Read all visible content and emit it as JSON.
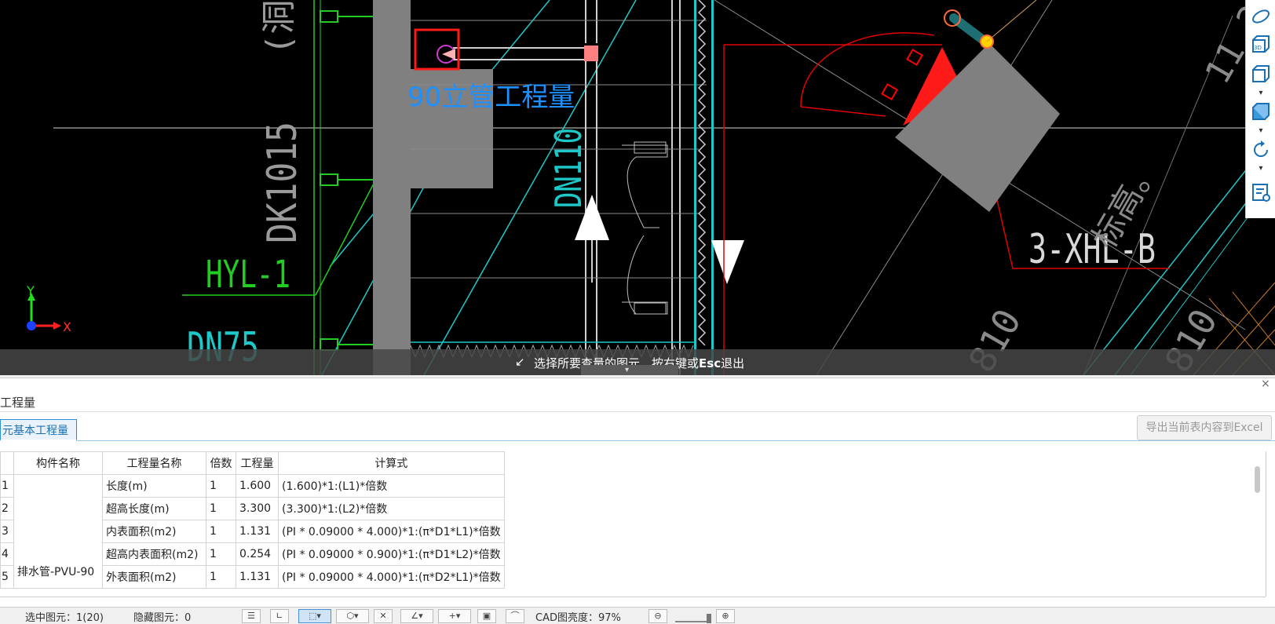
{
  "cad": {
    "labels": {
      "riser_quantity": "90立管工程量",
      "dk": "DK1015",
      "hyl": "HYL-1",
      "dn75": "DN75",
      "dn110": "DN110",
      "xhl": "3-XHL-B",
      "cropped_top": "(洞",
      "cropped_right_top": "11.2",
      "cropped_right_mid": "标高。",
      "cropped_bottom_1": "810",
      "cropped_bottom_2": "810"
    },
    "axis": {
      "y_label": "Y",
      "x_label": "X"
    },
    "hint": {
      "prefix": "选择所要查量的图元，按右键或",
      "key": "Esc",
      "suffix": "退出"
    },
    "colors": {
      "background": "#000000",
      "cyan": "#1ec8c8",
      "green": "#22cc22",
      "red": "#ff0000",
      "gray": "#808080",
      "blue_label": "#1e90ff"
    }
  },
  "right_toolbar": {
    "icons": [
      "rotate-view-icon",
      "3d-view-icon",
      "box-view-icon",
      "solid-view-icon",
      "refresh-icon",
      "property-view-icon"
    ],
    "view_3d_label": "3D"
  },
  "panel": {
    "title": "工程量",
    "tab": "元基本工程量",
    "export_button": "导出当前表内容到Excel",
    "columns": [
      "",
      "构件名称",
      "工程量名称",
      "倍数",
      "工程量",
      "计算式"
    ],
    "component_name": "排水管-PVU-90",
    "rows": [
      {
        "index": "1",
        "name": "长度(m)",
        "multiplier": "1",
        "quantity": "1.600",
        "formula": "(1.600)*1:(L1)*倍数"
      },
      {
        "index": "2",
        "name": "超高长度(m)",
        "multiplier": "1",
        "quantity": "3.300",
        "formula": "(3.300)*1:(L2)*倍数"
      },
      {
        "index": "3",
        "name": "内表面积(m2)",
        "multiplier": "1",
        "quantity": "1.131",
        "formula": "(PI * 0.09000 * 4.000)*1:(π*D1*L1)*倍数"
      },
      {
        "index": "4",
        "name": "超高内表面积(m2)",
        "multiplier": "1",
        "quantity": "0.254",
        "formula": "(PI * 0.09000 * 0.900)*1:(π*D1*L2)*倍数"
      },
      {
        "index": "5",
        "name": "外表面积(m2)",
        "multiplier": "1",
        "quantity": "1.131",
        "formula": "(PI * 0.09000 * 4.000)*1:(π*D2*L1)*倍数"
      }
    ]
  },
  "status": {
    "selected": "选中图元：1(20)",
    "hidden": "隐藏图元：0",
    "cad_brightness": "CAD图亮度：97%"
  }
}
